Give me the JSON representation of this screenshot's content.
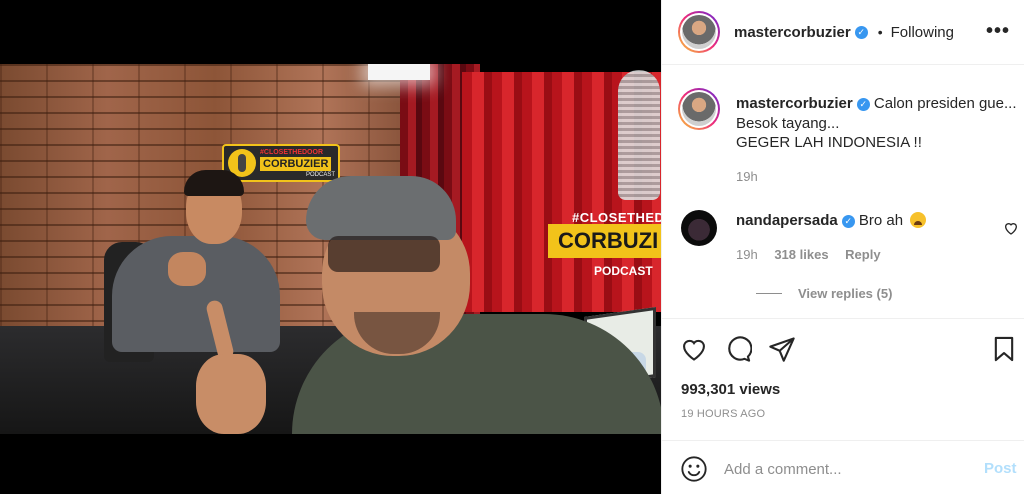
{
  "post": {
    "username": "mastercorbuzier",
    "follow_status": "Following",
    "more_label": "•••",
    "separator": "•"
  },
  "video_scene": {
    "sign_tag": "#CLOSETHEDOOR",
    "sign_main": "CORBUZIER",
    "sign_sub": "PODCAST",
    "screen_tag": "#CLOSETHEDO",
    "screen_banner": "CORBUZI",
    "screen_sub": "PODCAST"
  },
  "caption": {
    "username": "mastercorbuzier",
    "line1": "Calon presiden gue...",
    "line2": "Besok tayang...",
    "line3": "GEGER LAH INDONESIA !!",
    "time": "19h"
  },
  "comment": {
    "username": "nandapersada",
    "text": "Bro ah",
    "time": "19h",
    "likes": "318 likes",
    "reply_label": "Reply",
    "view_replies": "View replies (5)"
  },
  "stats": {
    "views": "993,301 views",
    "posted_ago": "19 HOURS AGO"
  },
  "add_comment": {
    "placeholder": "Add a comment...",
    "post_label": "Post"
  },
  "icons": {
    "like": "heart-icon",
    "comment": "comment-bubble-icon",
    "share": "paper-plane-icon",
    "save": "bookmark-icon",
    "emoji": "smiley-icon",
    "verified": "verified-badge-icon",
    "more": "more-options-icon"
  },
  "colors": {
    "verified": "#3897f0",
    "post_button_disabled": "#b2dffc",
    "muted_text": "#8e8e8e",
    "border": "#efefef"
  }
}
